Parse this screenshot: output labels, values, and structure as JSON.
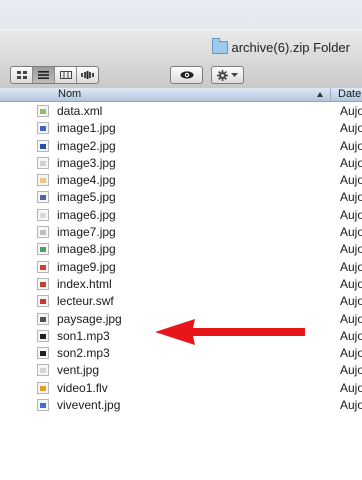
{
  "window": {
    "title": "archive(6).zip Folder"
  },
  "toolbar": {
    "view_buttons": [
      "icon-view",
      "list-view",
      "column-view",
      "coverflow-view"
    ],
    "active_view": "list-view",
    "quicklook_icon": "eye-icon",
    "action_icon": "gear-icon"
  },
  "columns": {
    "name": "Nom",
    "date": "Date"
  },
  "files": [
    {
      "name": "data.xml",
      "date": "Aujo",
      "icon": "xml-file-icon",
      "color": "#8fbf5a"
    },
    {
      "name": "image1.jpg",
      "date": "Aujo",
      "icon": "jpg-file-icon",
      "color": "#3b63c4"
    },
    {
      "name": "image2.jpg",
      "date": "Aujo",
      "icon": "jpg-file-icon",
      "color": "#2b4fa8"
    },
    {
      "name": "image3.jpg",
      "date": "Aujo",
      "icon": "jpg-file-icon",
      "color": "#cfcfcf"
    },
    {
      "name": "image4.jpg",
      "date": "Aujo",
      "icon": "jpg-file-icon",
      "color": "#e9c982"
    },
    {
      "name": "image5.jpg",
      "date": "Aujo",
      "icon": "jpg-file-icon",
      "color": "#4a67a6"
    },
    {
      "name": "image6.jpg",
      "date": "Aujo",
      "icon": "jpg-file-icon",
      "color": "#d9d9d9"
    },
    {
      "name": "image7.jpg",
      "date": "Aujo",
      "icon": "jpg-file-icon",
      "color": "#bdbdbd"
    },
    {
      "name": "image8.jpg",
      "date": "Aujo",
      "icon": "jpg-file-icon",
      "color": "#47a35f"
    },
    {
      "name": "image9.jpg",
      "date": "Aujo",
      "icon": "jpg-file-icon",
      "color": "#d23a3a"
    },
    {
      "name": "index.html",
      "date": "Aujo",
      "icon": "html-file-icon",
      "color": "#b9442a"
    },
    {
      "name": "lecteur.swf",
      "date": "Aujo",
      "icon": "swf-file-icon",
      "color": "#d8312c"
    },
    {
      "name": "paysage.jpg",
      "date": "Aujo",
      "icon": "jpg-file-icon",
      "color": "#4f4f4f"
    },
    {
      "name": "son1.mp3",
      "date": "Aujo",
      "icon": "mp3-file-icon",
      "color": "#1f1f1f"
    },
    {
      "name": "son2.mp3",
      "date": "Aujo",
      "icon": "mp3-file-icon",
      "color": "#1f1f1f"
    },
    {
      "name": "vent.jpg",
      "date": "Aujo",
      "icon": "jpg-file-icon",
      "color": "#d4d4d4"
    },
    {
      "name": "video1.flv",
      "date": "Aujo",
      "icon": "flv-file-icon",
      "color": "#e0a020"
    },
    {
      "name": "vivevent.jpg",
      "date": "Aujo",
      "icon": "jpg-file-icon",
      "color": "#3c6fd0"
    }
  ],
  "annotation": {
    "arrow_color": "#e8161b",
    "points_to": "lecteur.swf"
  }
}
